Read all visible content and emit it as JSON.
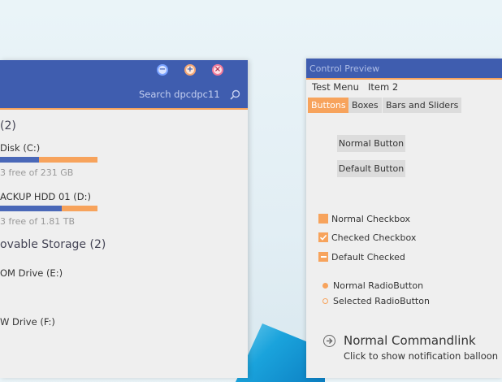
{
  "explorer": {
    "search_placeholder": "Search dpcdpc11",
    "group1_header": "(2)",
    "drives": [
      {
        "name": "Disk (C:)",
        "sub": "3 free of 231 GB",
        "used": 0.4
      },
      {
        "name": "ACKUP HDD 01 (D:)",
        "sub": "3 free of 1.81 TB",
        "used": 0.63
      }
    ],
    "group2_header": "ovable Storage (2)",
    "removable": [
      {
        "name": "OM Drive (E:)"
      },
      {
        "name": "W Drive (F:)"
      }
    ]
  },
  "preview": {
    "title": "Control Preview",
    "menu": [
      "Test Menu",
      "Item 2"
    ],
    "tabs": [
      "Buttons",
      "Boxes",
      "Bars and Sliders"
    ],
    "buttons": [
      "Normal Button",
      "Default Button"
    ],
    "checkboxes": [
      "Normal Checkbox",
      "Checked Checkbox",
      "Default Checked"
    ],
    "radios": [
      "Normal RadioButton",
      "Selected RadioButton"
    ],
    "commandlink": {
      "title": "Normal Commandlink",
      "note": "Click to show notification balloon"
    }
  },
  "colors": {
    "accent": "#f7a35c",
    "titlebar": "#3f5daf",
    "bar_fill": "#4a68b8"
  }
}
